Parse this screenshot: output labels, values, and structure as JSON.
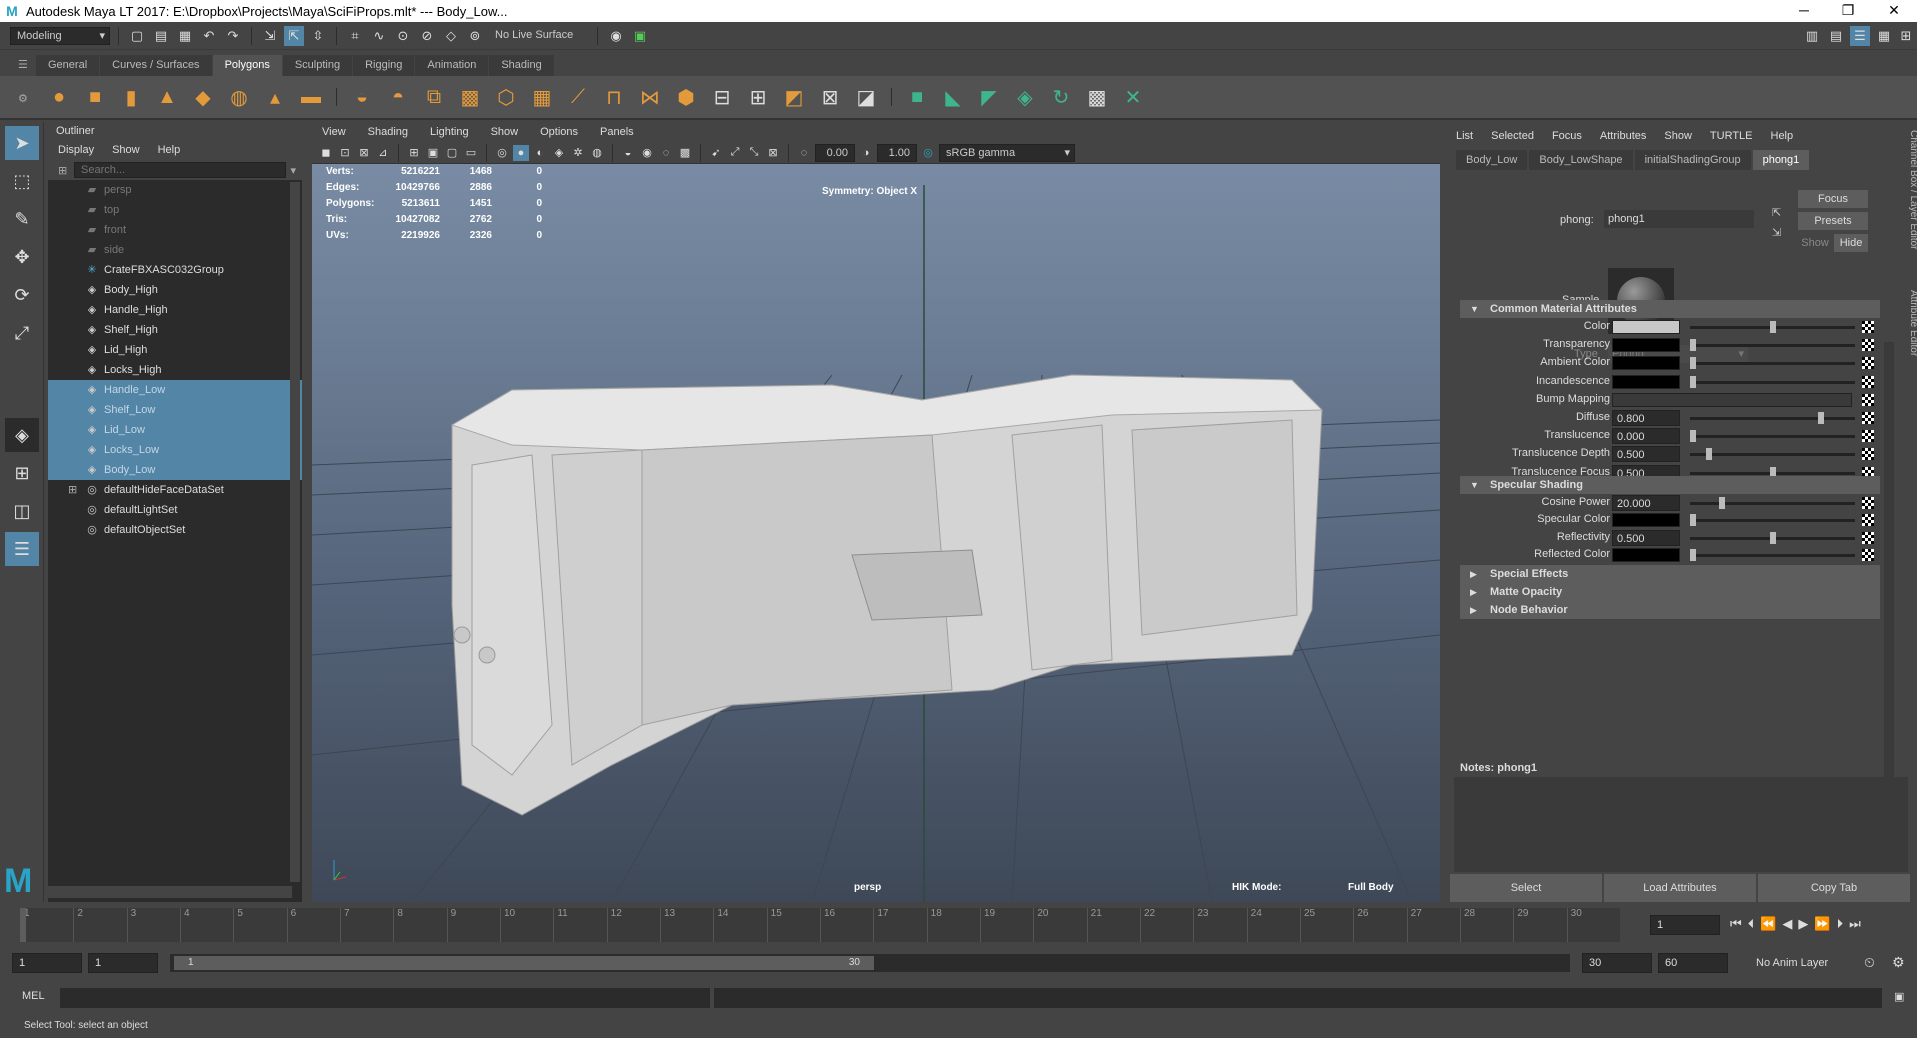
{
  "window": {
    "title": "Autodesk Maya LT 2017: E:\\Dropbox\\Projects\\Maya\\SciFiProps.mlt*  ---  Body_Low..."
  },
  "status_line": {
    "menu_set": "Modeling",
    "live_surface": "No Live Surface"
  },
  "shelf": {
    "tabs": [
      "General",
      "Curves / Surfaces",
      "Polygons",
      "Sculpting",
      "Rigging",
      "Animation",
      "Shading"
    ],
    "active_tab": "Polygons"
  },
  "outliner": {
    "title": "Outliner",
    "menu": [
      "Display",
      "Show",
      "Help"
    ],
    "search_placeholder": "Search...",
    "items": [
      {
        "label": "persp",
        "icon": "camera-icon",
        "state": "dim"
      },
      {
        "label": "top",
        "icon": "camera-icon",
        "state": "dim"
      },
      {
        "label": "front",
        "icon": "camera-icon",
        "state": "dim"
      },
      {
        "label": "side",
        "icon": "camera-icon",
        "state": "dim"
      },
      {
        "label": "CrateFBXASC032Group",
        "icon": "group-icon",
        "state": "normal"
      },
      {
        "label": "Body_High",
        "icon": "mesh-icon",
        "state": "normal"
      },
      {
        "label": "Handle_High",
        "icon": "mesh-icon",
        "state": "normal"
      },
      {
        "label": "Shelf_High",
        "icon": "mesh-icon",
        "state": "normal"
      },
      {
        "label": "Lid_High",
        "icon": "mesh-icon",
        "state": "normal"
      },
      {
        "label": "Locks_High",
        "icon": "mesh-icon",
        "state": "normal"
      },
      {
        "label": "Handle_Low",
        "icon": "mesh-icon",
        "state": "selected"
      },
      {
        "label": "Shelf_Low",
        "icon": "mesh-icon",
        "state": "selected"
      },
      {
        "label": "Lid_Low",
        "icon": "mesh-icon",
        "state": "selected"
      },
      {
        "label": "Locks_Low",
        "icon": "mesh-icon",
        "state": "selected"
      },
      {
        "label": "Body_Low",
        "icon": "mesh-icon",
        "state": "selected"
      },
      {
        "label": "defaultHideFaceDataSet",
        "icon": "set-icon",
        "state": "normal"
      },
      {
        "label": "defaultLightSet",
        "icon": "set-icon",
        "state": "normal"
      },
      {
        "label": "defaultObjectSet",
        "icon": "set-icon",
        "state": "normal"
      }
    ]
  },
  "viewport": {
    "menu": [
      "View",
      "Shading",
      "Lighting",
      "Show",
      "Options",
      "Panels"
    ],
    "exposure": "0.00",
    "gamma": "1.00",
    "color_space": "sRGB gamma",
    "hud_stats": [
      {
        "label": "Verts:",
        "total": "5216221",
        "selected": "1468",
        "extra": "0"
      },
      {
        "label": "Edges:",
        "total": "10429766",
        "selected": "2886",
        "extra": "0"
      },
      {
        "label": "Polygons:",
        "total": "5213611",
        "selected": "1451",
        "extra": "0"
      },
      {
        "label": "Tris:",
        "total": "10427082",
        "selected": "2762",
        "extra": "0"
      },
      {
        "label": "UVs:",
        "total": "2219926",
        "selected": "2326",
        "extra": "0"
      }
    ],
    "symmetry": "Symmetry: Object X",
    "camera_label": "persp",
    "hik_label": "HIK Mode:",
    "hik_value": "Full Body"
  },
  "attribute_editor": {
    "menu": [
      "List",
      "Selected",
      "Focus",
      "Attributes",
      "Show",
      "TURTLE",
      "Help"
    ],
    "tabs": [
      "Body_Low",
      "Body_LowShape",
      "initialShadingGroup",
      "phong1"
    ],
    "active_tab": "phong1",
    "node_label": "phong:",
    "node_name": "phong1",
    "focus_button": "Focus",
    "presets_button": "Presets",
    "show_button": "Show",
    "hide_button": "Hide",
    "sample_label": "Sample",
    "type_label": "Type",
    "type_value": "Phong",
    "sections": {
      "common": "Common Material Attributes",
      "specular": "Specular Shading",
      "special": "Special Effects",
      "matte": "Matte Opacity",
      "node": "Node Behavior"
    },
    "common_attrs": [
      {
        "label": "Color",
        "kind": "swatch",
        "swatch": "#c8c8c8",
        "slider": 0.5
      },
      {
        "label": "Transparency",
        "kind": "swatch",
        "swatch": "#000000",
        "slider": 0.0
      },
      {
        "label": "Ambient Color",
        "kind": "swatch",
        "swatch": "#000000",
        "slider": 0.0
      },
      {
        "label": "Incandescence",
        "kind": "swatch",
        "swatch": "#000000",
        "slider": 0.0
      },
      {
        "label": "Bump Mapping",
        "kind": "map"
      },
      {
        "label": "Diffuse",
        "kind": "number",
        "value": "0.800",
        "slider": 0.8
      },
      {
        "label": "Translucence",
        "kind": "number",
        "value": "0.000",
        "slider": 0.0
      },
      {
        "label": "Translucence Depth",
        "kind": "number",
        "value": "0.500",
        "slider": 0.1
      },
      {
        "label": "Translucence Focus",
        "kind": "number",
        "value": "0.500",
        "slider": 0.5
      }
    ],
    "specular_attrs": [
      {
        "label": "Cosine Power",
        "kind": "number",
        "value": "20.000",
        "slider": 0.18
      },
      {
        "label": "Specular Color",
        "kind": "swatch",
        "swatch": "#000000",
        "slider": 0.0
      },
      {
        "label": "Reflectivity",
        "kind": "number",
        "value": "0.500",
        "slider": 0.5
      },
      {
        "label": "Reflected Color",
        "kind": "swatch",
        "swatch": "#000000",
        "slider": 0.0
      }
    ],
    "notes": "Notes:  phong1",
    "buttons": [
      "Select",
      "Load Attributes",
      "Copy Tab"
    ]
  },
  "side_tabs": [
    "Channel Box / Layer Editor",
    "Attribute Editor"
  ],
  "timeline": {
    "ticks": [
      "1",
      "2",
      "3",
      "4",
      "5",
      "6",
      "7",
      "8",
      "9",
      "10",
      "11",
      "12",
      "13",
      "14",
      "15",
      "16",
      "17",
      "18",
      "19",
      "20",
      "21",
      "22",
      "23",
      "24",
      "25",
      "26",
      "27",
      "28",
      "29",
      "30"
    ],
    "current_frame": "1"
  },
  "range": {
    "start": "1",
    "playback_start": "1",
    "slider_start": "1",
    "slider_end": "30",
    "playback_end": "30",
    "end": "60",
    "anim_layer": "No Anim Layer"
  },
  "command_line": {
    "label": "MEL"
  },
  "help_line": "Select Tool: select an object",
  "colors": {
    "selection": "#5285a6",
    "panel": "#444444",
    "field": "#2b2b2b"
  }
}
